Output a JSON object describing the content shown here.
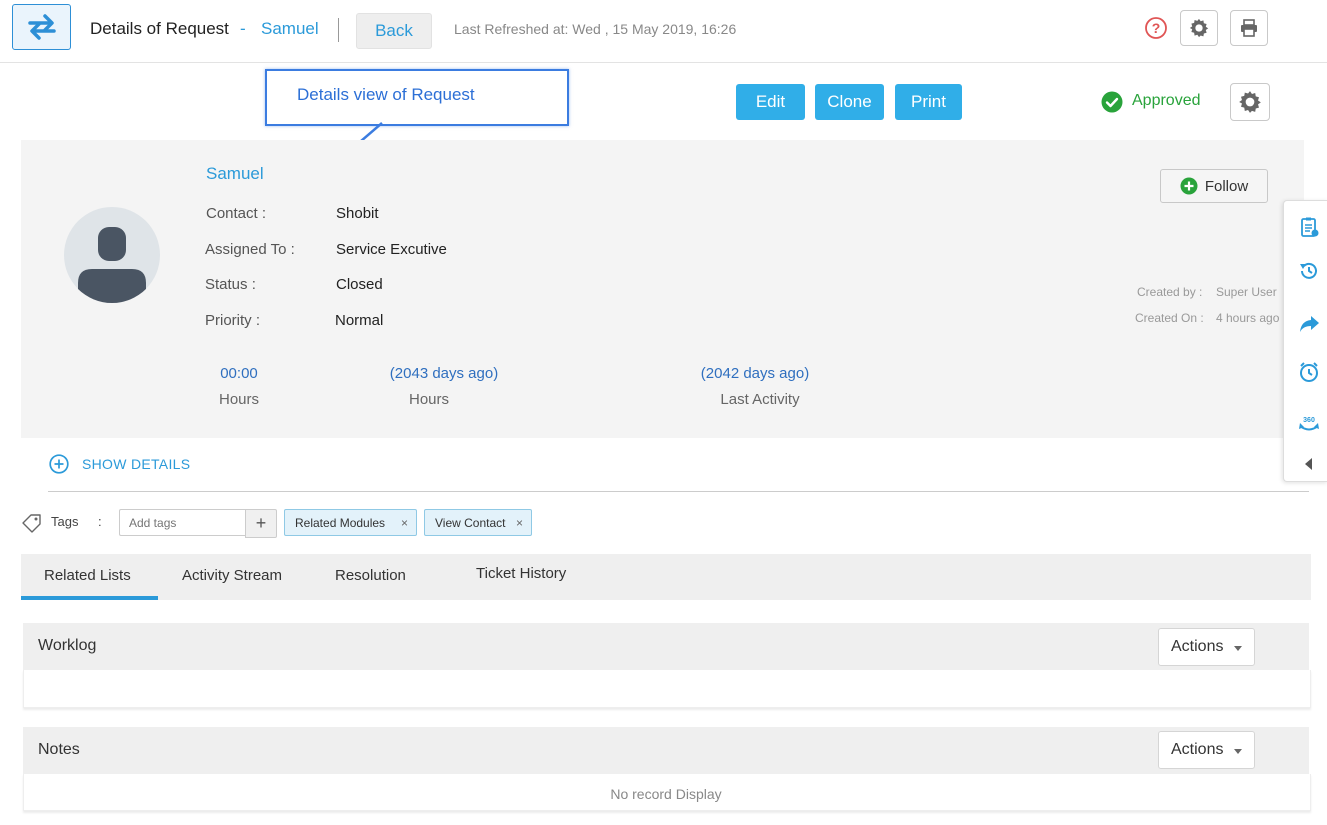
{
  "header": {
    "title": "Details of Request",
    "dash": "-",
    "requester": "Samuel",
    "back_label": "Back",
    "last_refreshed": "Last Refreshed at: Wed , 15 May 2019, 16:26"
  },
  "annotation": {
    "text": "Details view of Request"
  },
  "actions": {
    "edit": "Edit",
    "clone": "Clone",
    "print": "Print"
  },
  "status_badge": {
    "label": "Approved",
    "color": "#29a33b"
  },
  "detail": {
    "name": "Samuel",
    "fields": [
      {
        "label": "Contact  :",
        "value": "Shobit"
      },
      {
        "label": "Assigned To :",
        "value": "Service Excutive"
      },
      {
        "label": "Status  :",
        "value": "Closed"
      },
      {
        "label": "Priority :",
        "value": "Normal"
      }
    ],
    "follow_label": "Follow",
    "created_by_label": "Created by :",
    "created_by_value": "Super User",
    "created_on_label": "Created On :",
    "created_on_value": "4 hours ago",
    "stats": [
      {
        "value": "00:00",
        "label": "Hours"
      },
      {
        "value": "(2043 days ago)",
        "label": "Hours"
      },
      {
        "value": "(2042 days ago)",
        "label": "Last Activity"
      }
    ]
  },
  "show_details": "SHOW DETAILS",
  "tags": {
    "label": "Tags",
    "colon": ":",
    "placeholder": "Add tags",
    "add": "+",
    "chips": [
      "Related Modules",
      "View Contact"
    ],
    "remove": "×"
  },
  "tabs": [
    "Related Lists",
    "Activity Stream",
    "Resolution",
    "Ticket History"
  ],
  "sections": [
    {
      "title": "Worklog",
      "actions_label": "Actions"
    },
    {
      "title": "Notes",
      "actions_label": "Actions",
      "empty_text": "No record Display"
    }
  ],
  "colors": {
    "accent": "#2b9ad9",
    "button": "#30aee8",
    "annotation": "#3b7ce0"
  },
  "icons": [
    "swap-icon",
    "help-icon",
    "gear-icon",
    "print-icon",
    "check-circle-icon",
    "plus-circle-icon",
    "clipboard-icon",
    "history-icon",
    "share-icon",
    "alarm-icon",
    "360-icon",
    "collapse-left-icon",
    "tag-icon"
  ]
}
